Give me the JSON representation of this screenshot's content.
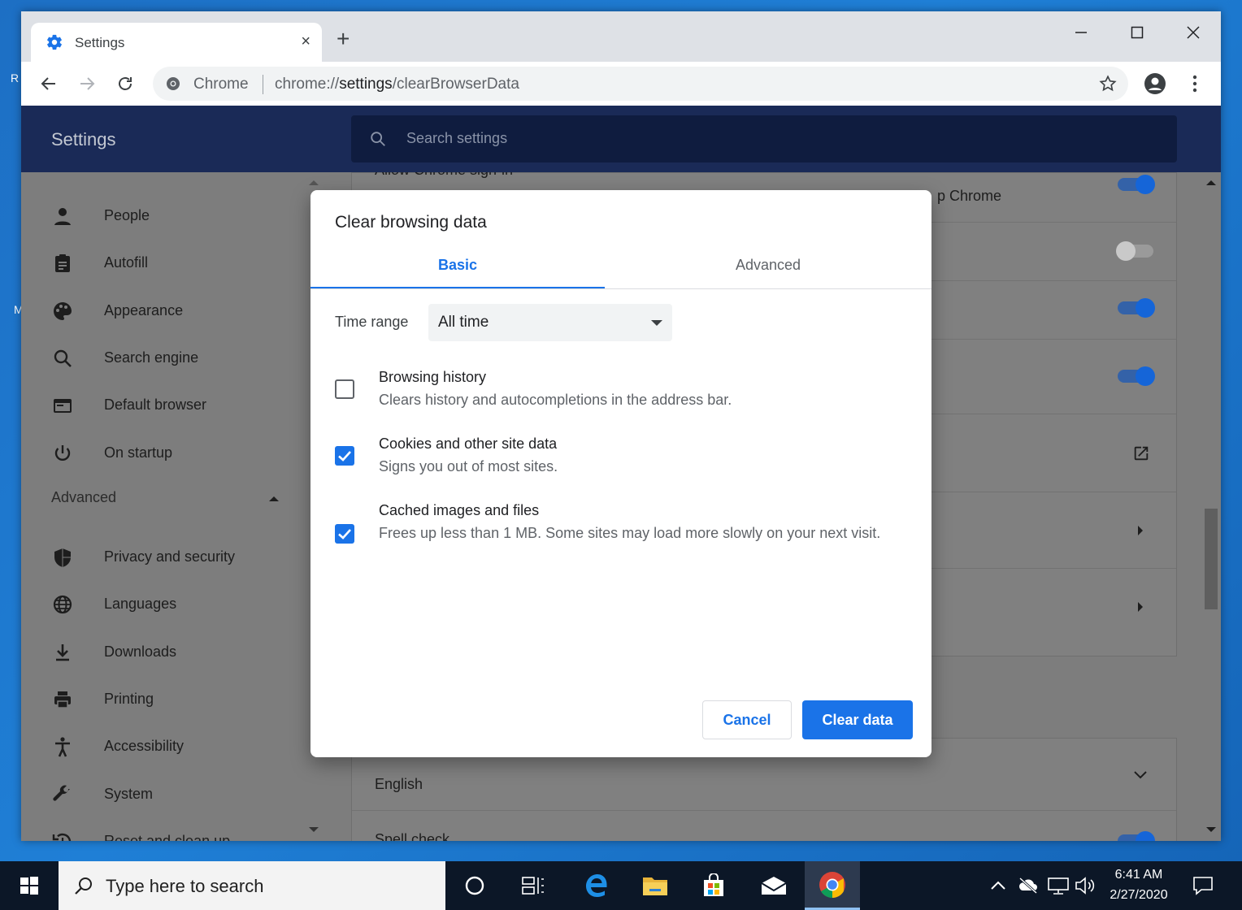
{
  "desktop": {
    "fragments": [
      "R",
      "M"
    ]
  },
  "browser": {
    "tab_title": "Settings",
    "tab_close": "×",
    "new_tab": "+",
    "omnibox": {
      "site_label": "Chrome",
      "url_scheme": "chrome://",
      "url_host": "settings",
      "url_path": "/clearBrowserData"
    }
  },
  "settings": {
    "title": "Settings",
    "search_placeholder": "Search settings",
    "sidebar": {
      "items": [
        {
          "label": "People",
          "icon": "person-icon"
        },
        {
          "label": "Autofill",
          "icon": "clipboard-icon"
        },
        {
          "label": "Appearance",
          "icon": "palette-icon"
        },
        {
          "label": "Search engine",
          "icon": "search-icon"
        },
        {
          "label": "Default browser",
          "icon": "browser-icon"
        },
        {
          "label": "On startup",
          "icon": "power-icon"
        }
      ],
      "advanced_label": "Advanced",
      "advanced_items": [
        {
          "label": "Privacy and security",
          "icon": "shield-icon"
        },
        {
          "label": "Languages",
          "icon": "globe-icon"
        },
        {
          "label": "Downloads",
          "icon": "download-icon"
        },
        {
          "label": "Printing",
          "icon": "printer-icon"
        },
        {
          "label": "Accessibility",
          "icon": "accessibility-icon"
        },
        {
          "label": "System",
          "icon": "wrench-icon"
        },
        {
          "label": "Reset and clean up",
          "icon": "history-icon"
        }
      ]
    },
    "background": {
      "row_partial_title": "Allow Chrome sign-in",
      "row_partial_desc": "p Chrome",
      "language_value": "English",
      "spell_check_label": "Spell check"
    }
  },
  "dialog": {
    "title": "Clear browsing data",
    "tabs": [
      {
        "label": "Basic",
        "active": true
      },
      {
        "label": "Advanced",
        "active": false
      }
    ],
    "time_range_label": "Time range",
    "time_range_value": "All time",
    "options": [
      {
        "title": "Browsing history",
        "desc": "Clears history and autocompletions in the address bar.",
        "checked": false
      },
      {
        "title": "Cookies and other site data",
        "desc": "Signs you out of most sites.",
        "checked": true
      },
      {
        "title": "Cached images and files",
        "desc": "Frees up less than 1 MB. Some sites may load more slowly on your next visit.",
        "checked": true
      }
    ],
    "cancel_label": "Cancel",
    "clear_label": "Clear data"
  },
  "taskbar": {
    "search_placeholder": "Type here to search",
    "time": "6:41 AM",
    "date": "2/27/2020"
  },
  "colors": {
    "accent": "#1a73e8",
    "settings_header": "#1a2a57",
    "overlay_gray": "#7d7d7d",
    "taskbar": "#0c1727"
  }
}
